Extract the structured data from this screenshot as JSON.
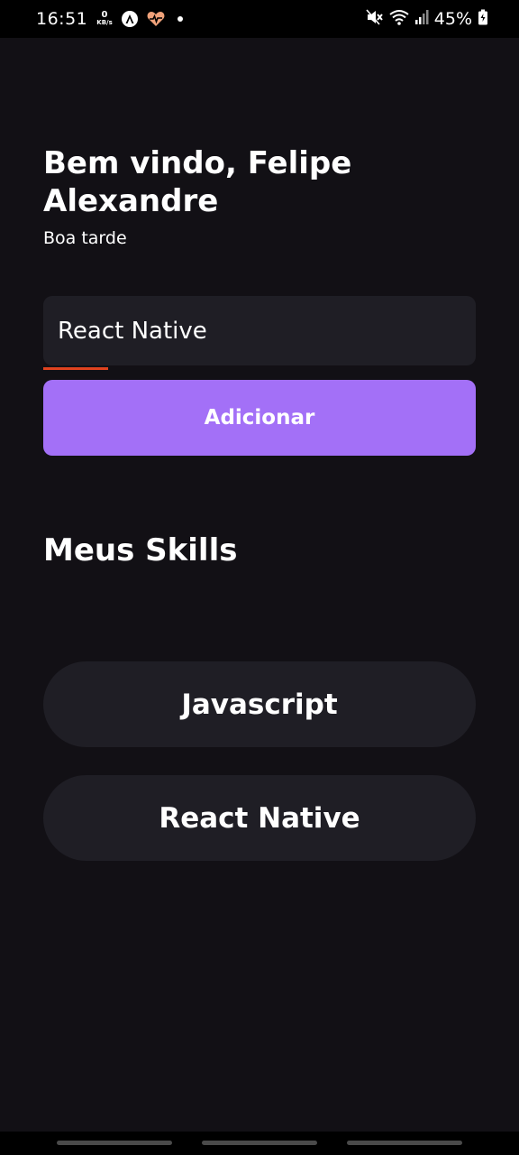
{
  "status_bar": {
    "time": "16:51",
    "netspeed_value": "0",
    "netspeed_unit": "KB/s",
    "battery": "45%",
    "icons": [
      "a-icon",
      "heart-pulse-icon",
      "dot-icon",
      "mute-icon",
      "wifi-icon",
      "signal-icon",
      "battery-icon"
    ]
  },
  "header": {
    "greeting": "Bem vindo, Felipe Alexandre",
    "subgreeting": "Boa tarde"
  },
  "form": {
    "input_value": "React Native",
    "button_label": "Adicionar"
  },
  "skills": {
    "title": "Meus Skills",
    "items": [
      "Javascript",
      "React Native"
    ]
  },
  "colors": {
    "background": "#121015",
    "card": "#1f1e25",
    "accent": "#a370f7",
    "spellcheck": "#e0431f"
  }
}
